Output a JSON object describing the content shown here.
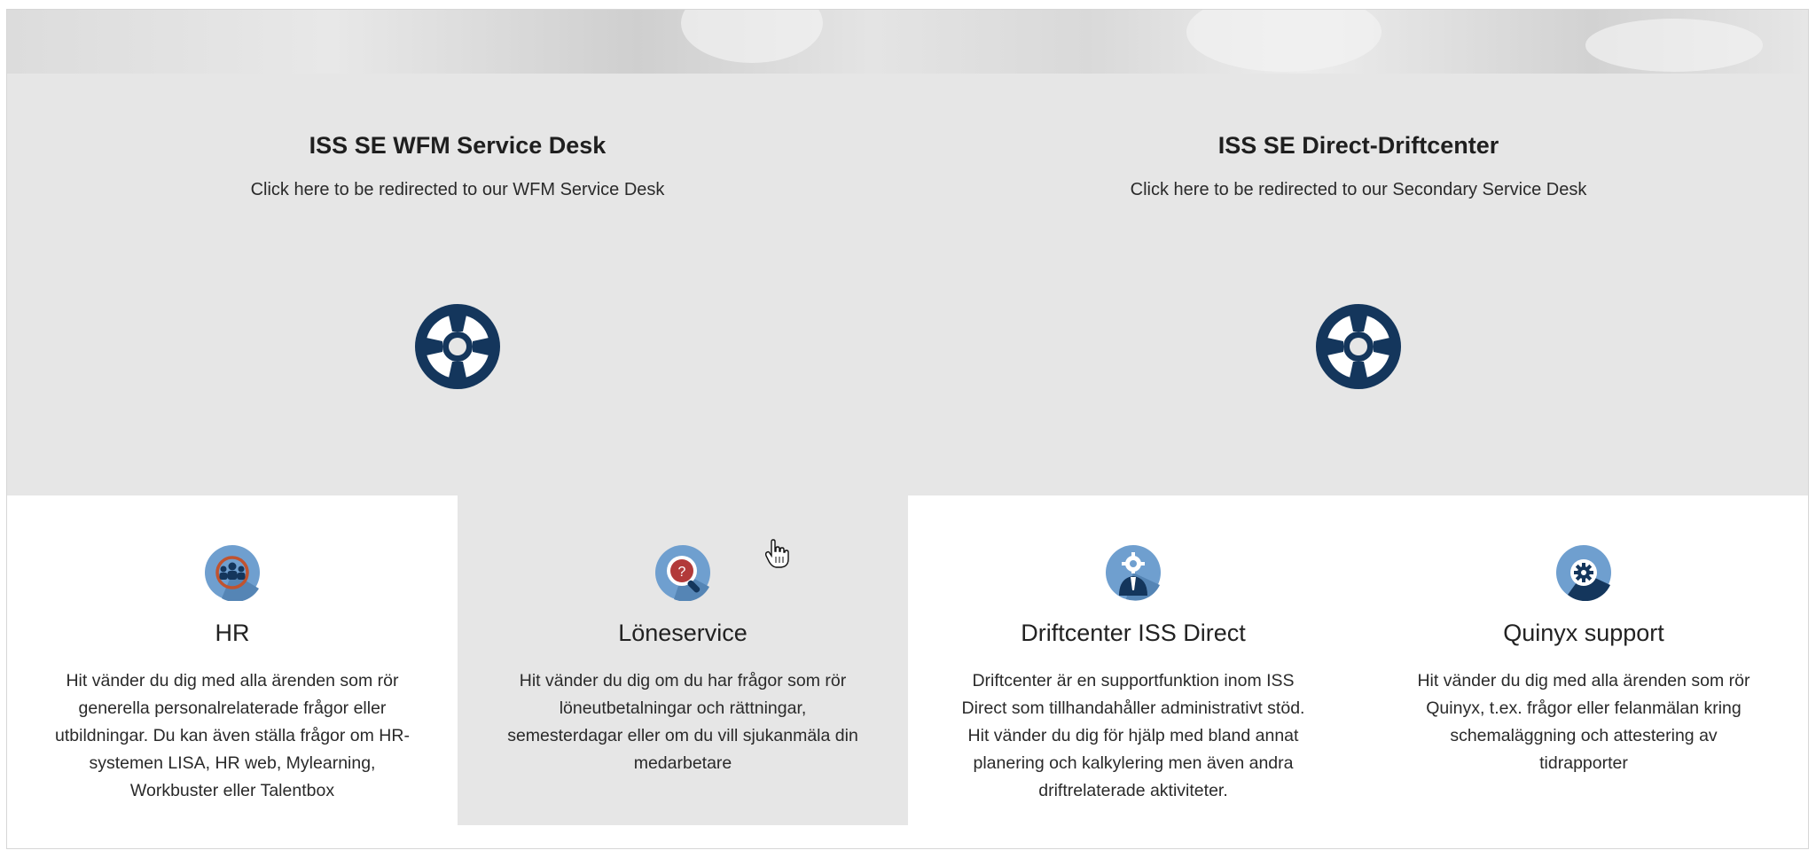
{
  "service_desks": [
    {
      "title": "ISS SE WFM Service Desk",
      "subtitle": "Click here to be redirected to our WFM Service Desk",
      "icon": "lifebuoy-icon"
    },
    {
      "title": "ISS SE Direct-Driftcenter",
      "subtitle": "Click here to be redirected to our Secondary Service Desk",
      "icon": "lifebuoy-icon"
    }
  ],
  "cards": [
    {
      "title": "HR",
      "icon": "hr-people-icon",
      "lines": [
        "Hit vänder du dig med alla ärenden som rör",
        "generella personalrelaterade frågor eller",
        "utbildningar. Du kan även ställa frågor om HR-",
        "systemen LISA, HR web, Mylearning,",
        "Workbuster eller Talentbox"
      ]
    },
    {
      "title": "Löneservice",
      "icon": "question-search-icon",
      "lines": [
        "Hit vänder du dig om du har frågor som rör",
        "löneutbetalningar och rättningar,",
        "semesterdagar eller om du vill sjukanmäla din",
        "medarbetare"
      ]
    },
    {
      "title": "Driftcenter ISS Direct",
      "icon": "support-agent-icon",
      "lines": [
        "Driftcenter är en supportfunktion inom ISS",
        "Direct som tillhandahåller administrativt stöd.",
        "Hit vänder du dig för hjälp med bland annat",
        "planering och kalkylering men även andra",
        "driftrelaterade aktiviteter."
      ]
    },
    {
      "title": "Quinyx support",
      "icon": "gear-icon",
      "lines": [
        "Hit vänder du dig med alla ärenden som rör",
        "Quinyx, t.ex. frågor eller felanmälan kring",
        "schemaläggning och attestering av",
        "tidrapporter"
      ]
    }
  ],
  "colors": {
    "icon_navy": "#14365c",
    "icon_light_blue": "#6f9fcf",
    "panel_gray": "#e6e6e6",
    "accent_red": "#b23a3a"
  }
}
